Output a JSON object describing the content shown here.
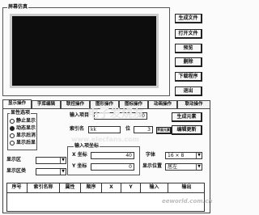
{
  "preview": {
    "title": "屏幕仿真"
  },
  "right_buttons": [
    "生成文件",
    "打开文件",
    "预览",
    "删除",
    "下载程序",
    "退出"
  ],
  "tabs": [
    "显示操作",
    "字库编辑",
    "联控操作",
    "图形操作",
    "图标操作",
    "动画操作",
    "联动操作"
  ],
  "display_group": {
    "title": "显性选项",
    "options": [
      "静止显示",
      "动态显示",
      "显示后消",
      "显示后显"
    ],
    "selected": 1
  },
  "input_row": {
    "label": "输入项目",
    "value": "10"
  },
  "buttons": {
    "generate": "生成元素",
    "edit": "编辑更新"
  },
  "index_row": {
    "label": "索引名",
    "value": "kk",
    "digits_label": "位",
    "digits_value": "3",
    "small_btn": "界面元素"
  },
  "left_fields": [
    {
      "label": "显示区",
      "value": ""
    },
    {
      "label": "显示区类",
      "value": ""
    }
  ],
  "coord_group": {
    "title": "输入项坐标",
    "x_label": "X 坐标",
    "x_value": "40",
    "y_label": "Y 坐标",
    "y_value": "0"
  },
  "font_row": {
    "label": "字体",
    "value": "16 × 8"
  },
  "align_row": {
    "label": "显示位置",
    "value": "居左"
  },
  "table": {
    "headers": [
      "序号",
      "索引名称",
      "属性",
      "顺序",
      "X",
      "Y",
      "输入",
      "输出"
    ]
  },
  "watermarks": [
    "电子发烧友",
    "www.elecfans.com",
    "eeworld.com.cn"
  ]
}
